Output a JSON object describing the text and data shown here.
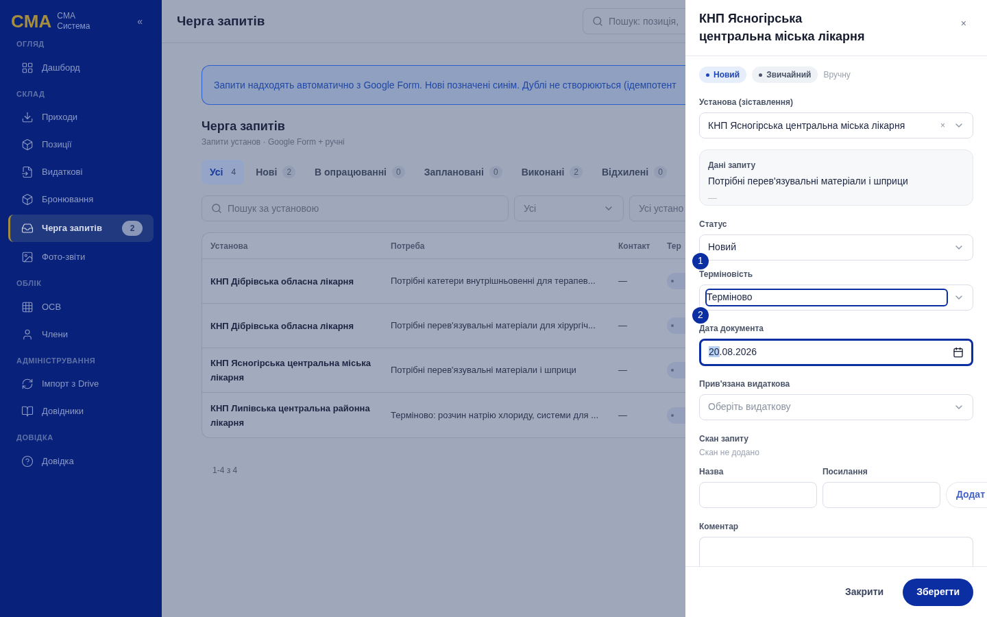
{
  "sidebar": {
    "logo": "CMA",
    "brand_line_1": "CMA",
    "brand_line_2": "Система",
    "collapse": "«",
    "sections": [
      {
        "heading": "ОГЛЯД",
        "items": [
          {
            "label": "Дашборд",
            "kind": "grid",
            "selected": false
          }
        ]
      },
      {
        "heading": "СКЛАД",
        "items": [
          {
            "label": "Приходи",
            "kind": "download",
            "selected": false
          },
          {
            "label": "Позиції",
            "kind": "box",
            "selected": false
          },
          {
            "label": "Видаткові",
            "kind": "file",
            "selected": false
          },
          {
            "label": "Бронювання",
            "kind": "box",
            "selected": false
          },
          {
            "label": "Черга запитів",
            "kind": "inbox",
            "selected": true,
            "badge": "2"
          },
          {
            "label": "Фото-звіти",
            "kind": "image",
            "selected": false
          }
        ]
      },
      {
        "heading": "ОБЛІК",
        "items": [
          {
            "label": "ОСВ",
            "kind": "table",
            "selected": false
          },
          {
            "label": "Члени",
            "kind": "user",
            "selected": false
          }
        ]
      },
      {
        "heading": "АДМІНІСТРУВАННЯ",
        "items": [
          {
            "label": "Імпорт з Drive",
            "kind": "refresh",
            "selected": false
          },
          {
            "label": "Довідники",
            "kind": "book",
            "selected": false
          }
        ]
      },
      {
        "heading": "ДОВІДКА",
        "items": [
          {
            "label": "Довідка",
            "kind": "help",
            "selected": false
          }
        ]
      }
    ]
  },
  "header": {
    "title": "Черга запитів",
    "search_placeholder": "Пошук: позиція,"
  },
  "notice": "Запити надходять автоматично з Google Form. Нові позначені синім. Дублі не створюються (ідемпотент",
  "page": {
    "title": "Черга запитів",
    "subtitle": "Запити установ · Google Form + ручні"
  },
  "tabs": [
    {
      "label": "Усі",
      "count": "4",
      "selected": true
    },
    {
      "label": "Нові",
      "count": "2",
      "selected": false
    },
    {
      "label": "В опрацюванні",
      "count": "0",
      "selected": false
    },
    {
      "label": "Заплановані",
      "count": "0",
      "selected": false
    },
    {
      "label": "Виконані",
      "count": "2",
      "selected": false
    },
    {
      "label": "Відхилені",
      "count": "0",
      "selected": false
    }
  ],
  "filters": {
    "search_placeholder": "Пошук за установою",
    "status": "Усі",
    "institution": "Усі устано"
  },
  "table": {
    "columns": [
      "Установа",
      "Потреба",
      "Контакт",
      "Тер"
    ],
    "rows": [
      {
        "institution": "КНП Дібрівська обласна лікарня",
        "need": "Потрібні катетери внутрішньовенні для терапев...",
        "contact": "—"
      },
      {
        "institution": "КНП Дібрівська обласна лікарня",
        "need": "Потрібні перев'язувальні матеріали для хірургіч...",
        "contact": "—"
      },
      {
        "institution": "КНП Ясногірська центральна міська лікарня",
        "need": "Потрібні перев'язувальні матеріали і шприци",
        "contact": "—"
      },
      {
        "institution": "КНП Липівська центральна районна лікарня",
        "need": "Терміново: розчин натрію хлориду, системи для ...",
        "contact": "—"
      }
    ]
  },
  "pagination": "1-4 з 4",
  "drawer": {
    "title": "КНП Ясногірська центральна міська лікарня",
    "close": "×",
    "badges": [
      {
        "label": "Новий",
        "kind": "blue"
      },
      {
        "label": "Звичайний",
        "kind": "gray"
      },
      {
        "label": "Вручну",
        "kind": "plain"
      }
    ],
    "institution_label": "Установа (зіставлення)",
    "institution_value": "КНП Ясногірська центральна міська лікарня",
    "clear": "×",
    "request": {
      "heading": "Дані запиту",
      "text": "Потрібні перев'язувальні матеріали і шприци",
      "contact": "—"
    },
    "status_label": "Статус",
    "status_value": "Новий",
    "urgency_label": "Терміновість",
    "urgency_value": "Терміново",
    "date_label": "Дата документа",
    "date_day": "20",
    "date_rest": ".08.2026",
    "expense_label": "Прив'язана видаткова",
    "expense_placeholder": "Оберіть видаткову",
    "scan_label": "Скан запиту",
    "scan_note": "Скан не додано",
    "name_label": "Назва",
    "link_label": "Посилання",
    "add_button": "Додат",
    "comment_label": "Коментар",
    "close_button": "Закрити",
    "save_button": "Зберегти"
  },
  "markers": [
    "1",
    "2"
  ]
}
